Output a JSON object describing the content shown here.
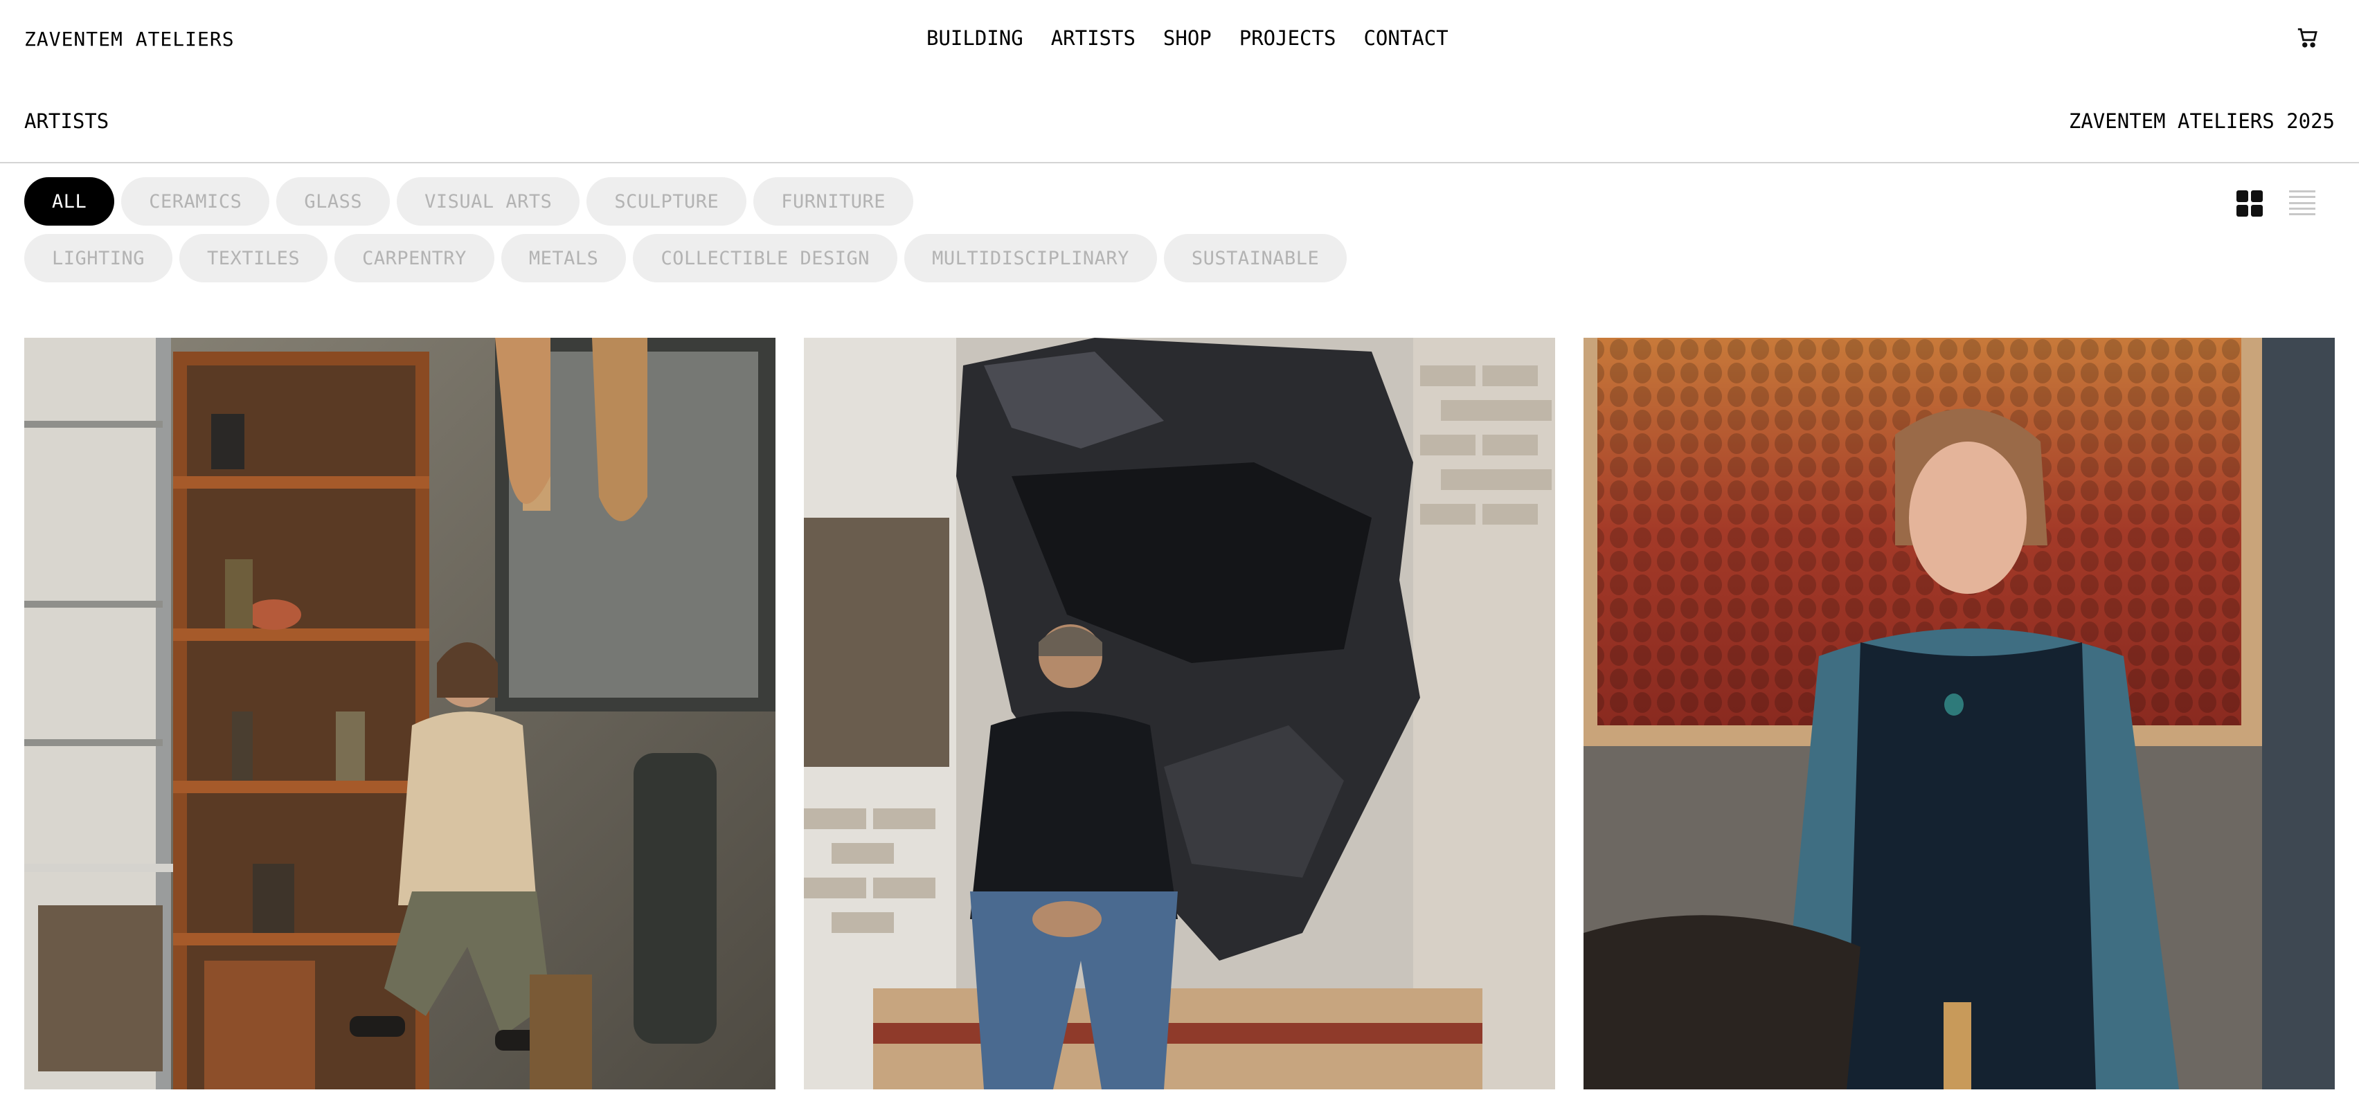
{
  "header": {
    "logo": "ZAVENTEM ATELIERS",
    "nav": [
      "BUILDING",
      "ARTISTS",
      "SHOP",
      "PROJECTS",
      "CONTACT"
    ],
    "cart_icon": "cart-icon"
  },
  "subheader": {
    "title": "ARTISTS",
    "year_label": "ZAVENTEM ATELIERS 2025"
  },
  "filters": {
    "row1": [
      "ALL",
      "CERAMICS",
      "GLASS",
      "VISUAL ARTS",
      "SCULPTURE",
      "FURNITURE"
    ],
    "row2": [
      "LIGHTING",
      "TEXTILES",
      "CARPENTRY",
      "METALS",
      "COLLECTIBLE DESIGN",
      "MULTIDISCIPLINARY",
      "SUSTAINABLE"
    ],
    "active": "ALL"
  },
  "view_toggle": {
    "grid_icon": "grid-view-icon",
    "list_icon": "list-view-icon"
  },
  "gallery": {
    "cards": [
      {
        "image": "photo-artist-ceramics-studio"
      },
      {
        "image": "photo-artist-sculpture-rock"
      },
      {
        "image": "photo-artist-textile-wall"
      }
    ]
  },
  "colors": {
    "active_chip": "#000000",
    "chip_bg": "#eeeeee",
    "chip_text": "#b3b3b3",
    "divider": "#d4d4d4"
  }
}
